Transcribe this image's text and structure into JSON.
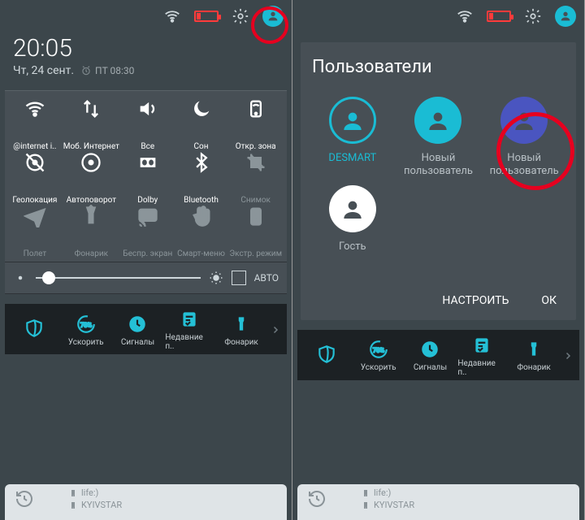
{
  "statusbar": {
    "wifi_icon": "wifi",
    "battery_level_pct": 15
  },
  "clock": {
    "time": "20:05",
    "date": "Чт, 24 сент.",
    "alarm": "ПТ 08:30"
  },
  "qs": {
    "row1": [
      {
        "label": "@internet i..",
        "icon": "wifi",
        "dim": false
      },
      {
        "label": "Моб. Интернет",
        "icon": "data",
        "dim": false
      },
      {
        "label": "Все",
        "icon": "volume",
        "dim": false
      },
      {
        "label": "Сон",
        "icon": "moon",
        "dim": false
      },
      {
        "label": "Откр. зона",
        "icon": "hotspot",
        "dim": false
      }
    ],
    "row2": [
      {
        "label": "Геолокация",
        "icon": "gps-off",
        "dim": false
      },
      {
        "label": "Автоповорот",
        "icon": "rotate",
        "dim": false
      },
      {
        "label": "Dolby",
        "icon": "dolby",
        "dim": false
      },
      {
        "label": "Bluetooth",
        "icon": "bluetooth",
        "dim": false
      },
      {
        "label": "Снимок",
        "icon": "crop",
        "dim": true
      }
    ],
    "row3": [
      {
        "label": "Полет",
        "icon": "plane",
        "dim": true
      },
      {
        "label": "Фонарик",
        "icon": "torch",
        "dim": true
      },
      {
        "label": "Беспр. экран",
        "icon": "cast",
        "dim": true
      },
      {
        "label": "Смарт-меню",
        "icon": "hand",
        "dim": true
      },
      {
        "label": "Экстр. режим",
        "icon": "battery-bolt",
        "dim": true
      }
    ]
  },
  "brightness": {
    "auto_label": "АВТО",
    "value_pct": 8
  },
  "strip": [
    {
      "label": "",
      "icon": "shield"
    },
    {
      "label": "Ускорить",
      "icon": "gauge",
      "badge": "78%"
    },
    {
      "label": "Сигналы",
      "icon": "clock"
    },
    {
      "label": "Недавние п..",
      "icon": "note"
    },
    {
      "label": "Фонарик",
      "icon": "flashlight"
    }
  ],
  "carrier": {
    "net1": "life:)",
    "net2": "KYIVSTAR"
  },
  "users_title": "Пользователи",
  "users": [
    {
      "name": "DESMART",
      "active": true,
      "ring": "#1abcd4",
      "fill": "transparent"
    },
    {
      "name": "Новый\nпользователь",
      "active": false,
      "ring": "none",
      "fill": "#1abcd4"
    },
    {
      "name": "Новый\nпользователь",
      "active": false,
      "ring": "none",
      "fill": "#4a55c0"
    },
    {
      "name": "Гость",
      "active": false,
      "ring": "none",
      "fill": "#ffffff"
    }
  ],
  "actions": {
    "configure": "НАСТРОИТЬ",
    "ok": "ОК"
  }
}
